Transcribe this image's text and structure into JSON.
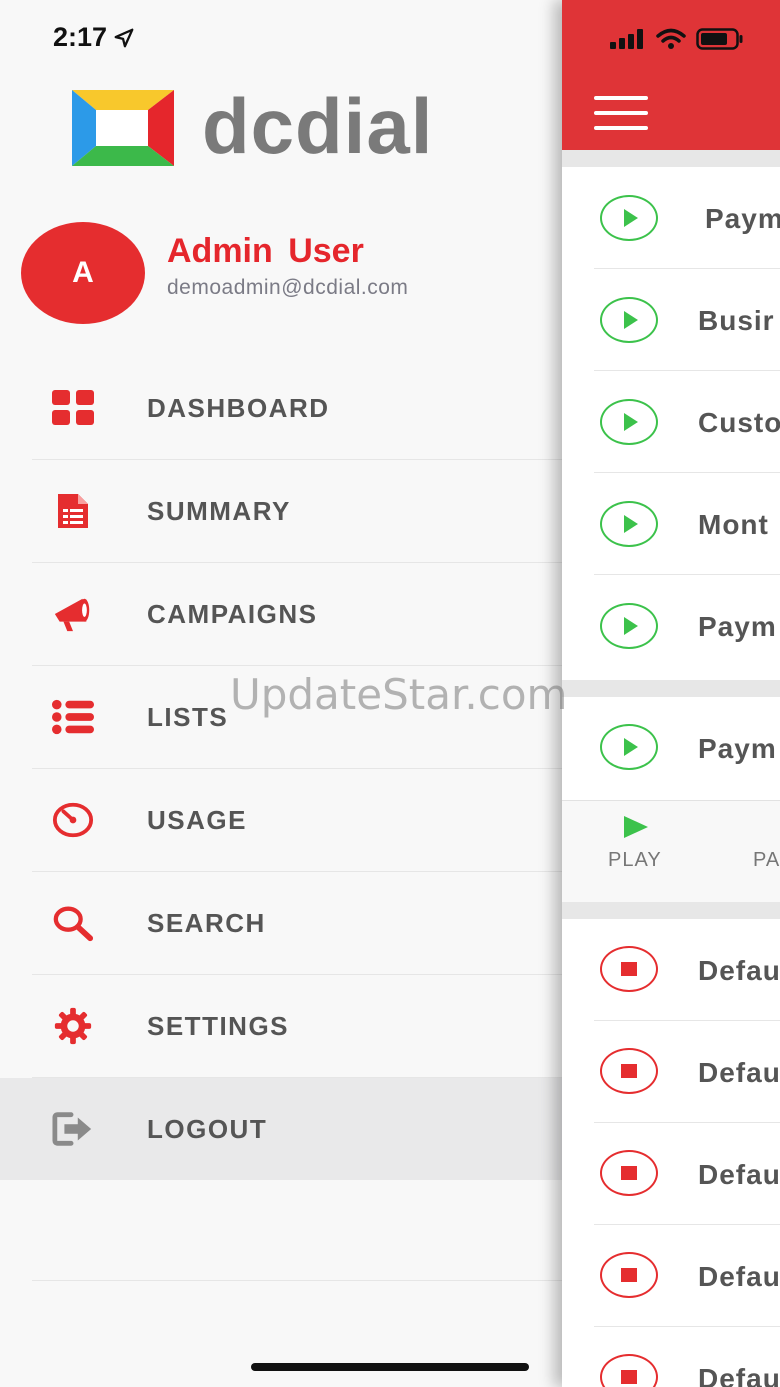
{
  "status_bar": {
    "time": "2:17"
  },
  "brand": {
    "name": "dcdial"
  },
  "user": {
    "initial": "A",
    "name": "Admin User",
    "email": "demoadmin@dcdial.com"
  },
  "menu": {
    "items": [
      {
        "label": "DASHBOARD",
        "icon": "grid-icon"
      },
      {
        "label": "SUMMARY",
        "icon": "document-icon"
      },
      {
        "label": "CAMPAIGNS",
        "icon": "megaphone-icon"
      },
      {
        "label": "LISTS",
        "icon": "list-icon"
      },
      {
        "label": "USAGE",
        "icon": "gauge-icon"
      },
      {
        "label": "SEARCH",
        "icon": "search-icon"
      },
      {
        "label": "SETTINGS",
        "icon": "gear-icon"
      },
      {
        "label": "LOGOUT",
        "icon": "logout-icon"
      }
    ]
  },
  "watermark": "UpdateStar.com",
  "campaigns": {
    "active": [
      "Paym",
      "Busir",
      "Custo",
      "Mont",
      "Paym"
    ],
    "selected": "Paym",
    "controls": [
      {
        "label": "PLAY"
      },
      {
        "label": "PA"
      }
    ],
    "stopped": [
      "Defau",
      "Defau",
      "Defau",
      "Defau",
      "Defau"
    ]
  },
  "colors": {
    "accent": "#e52d2f",
    "play": "#3cc24b",
    "text": "#555555"
  }
}
